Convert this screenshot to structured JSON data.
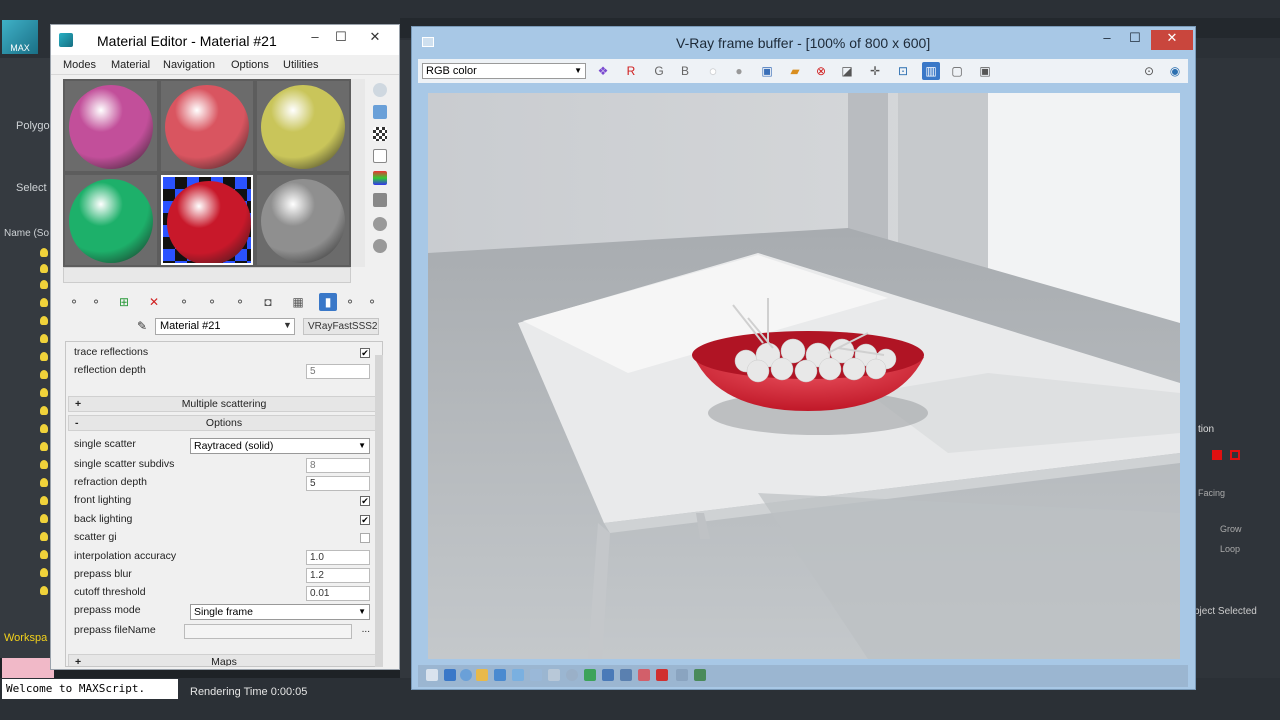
{
  "material_editor": {
    "title": "Material Editor - Material #21",
    "window_buttons": {
      "minimize": "–",
      "maximize": "☐",
      "close": "✕"
    },
    "menu": [
      "Modes",
      "Material",
      "Navigation",
      "Options",
      "Utilities"
    ],
    "slots": [
      {
        "color": "#c24f9a"
      },
      {
        "color": "#d95560"
      },
      {
        "color": "#c9c55a"
      },
      {
        "color": "#1db06a"
      },
      {
        "color": "#c8182a",
        "active": true
      },
      {
        "color": "#8f8f8f"
      }
    ],
    "material_name": "Material #21",
    "material_type": "VRayFastSSS2",
    "params": {
      "trace_reflections": {
        "label": "trace reflections",
        "checked": true
      },
      "reflection_depth": {
        "label": "reflection depth",
        "value": "5"
      },
      "rollout_multiple_scattering": "Multiple scattering",
      "rollout_options": "Options",
      "single_scatter": {
        "label": "single scatter",
        "value": "Raytraced (solid)"
      },
      "single_scatter_subdivs": {
        "label": "single scatter subdivs",
        "value": "8"
      },
      "refraction_depth": {
        "label": "refraction depth",
        "value": "5"
      },
      "front_lighting": {
        "label": "front lighting",
        "checked": true
      },
      "back_lighting": {
        "label": "back lighting",
        "checked": true
      },
      "scatter_gi": {
        "label": "scatter gi",
        "checked": false
      },
      "interpolation_accuracy": {
        "label": "interpolation accuracy",
        "value": "1.0"
      },
      "prepass_blur": {
        "label": "prepass blur",
        "value": "1.2"
      },
      "cutoff_threshold": {
        "label": "cutoff threshold",
        "value": "0.01"
      },
      "prepass_mode": {
        "label": "prepass mode",
        "value": "Single frame"
      },
      "prepass_filename": {
        "label": "prepass fileName",
        "value": "",
        "browse": "..."
      },
      "rollout_maps": "Maps"
    }
  },
  "vfb": {
    "title": "V-Ray frame buffer - [100% of 800 x 600]",
    "channel": "RGB color",
    "rgb_buttons": [
      "R",
      "G",
      "B"
    ],
    "window_buttons": {
      "minimize": "–",
      "maximize": "☐",
      "close": "✕"
    }
  },
  "max": {
    "left_panel": {
      "select": "Select",
      "polygon": "Polygo",
      "name_header": "Name (So",
      "workspace": "Workspa"
    },
    "maxscript": "Welcome to MAXScript.",
    "render_time": "Rendering Time  0:00:05",
    "right_panel": {
      "tion": "tion",
      "facing": "Facing",
      "grow": "Grow",
      "loop": "Loop",
      "selected": "bject Selected"
    }
  },
  "colors": {
    "bowl": "#d42a3a",
    "titlebar_active": "#a8c8e6",
    "workspace_text": "#f2d11b"
  }
}
